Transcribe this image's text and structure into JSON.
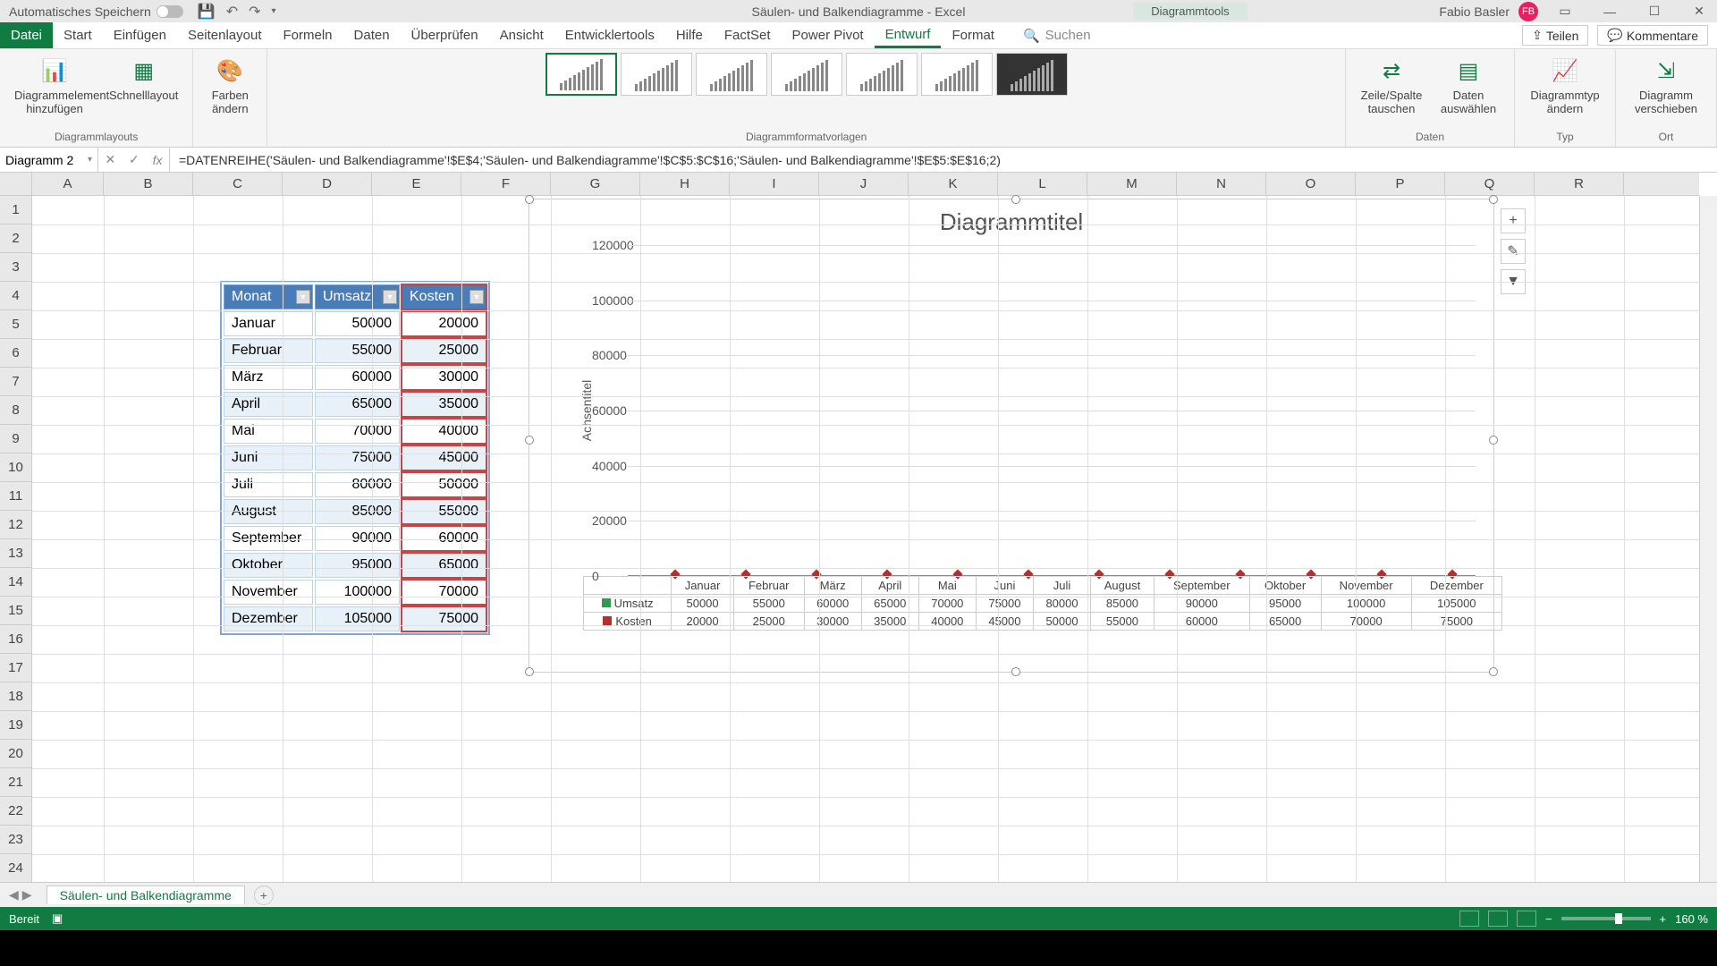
{
  "title_bar": {
    "autosave_label": "Automatisches Speichern",
    "doc_title": "Säulen- und Balkendiagramme - Excel",
    "tools_title": "Diagrammtools",
    "user_name": "Fabio Basler",
    "user_initials": "FB"
  },
  "ribbon_tabs": {
    "file": "Datei",
    "tabs": [
      "Start",
      "Einfügen",
      "Seitenlayout",
      "Formeln",
      "Daten",
      "Überprüfen",
      "Ansicht",
      "Entwicklertools",
      "Hilfe",
      "FactSet",
      "Power Pivot",
      "Entwurf",
      "Format"
    ],
    "active": "Entwurf",
    "search_placeholder": "Suchen",
    "share": "Teilen",
    "comments": "Kommentare"
  },
  "ribbon": {
    "group_layouts": "Diagrammlayouts",
    "btn_add_element": "Diagrammelement hinzufügen",
    "btn_quick_layout": "Schnelllayout",
    "btn_colors": "Farben ändern",
    "group_styles": "Diagrammformatvorlagen",
    "group_data": "Daten",
    "btn_switch": "Zeile/Spalte tauschen",
    "btn_select_data": "Daten auswählen",
    "group_type": "Typ",
    "btn_change_type": "Diagrammtyp ändern",
    "group_location": "Ort",
    "btn_move": "Diagramm verschieben"
  },
  "formula_bar": {
    "name_box": "Diagramm 2",
    "formula": "=DATENREIHE('Säulen- und Balkendiagramme'!$E$4;'Säulen- und Balkendiagramme'!$C$5:$C$16;'Säulen- und Balkendiagramme'!$E$5:$E$16;2)"
  },
  "columns": [
    "A",
    "B",
    "C",
    "D",
    "E",
    "F",
    "G",
    "H",
    "I",
    "J",
    "K",
    "L",
    "M",
    "N",
    "O",
    "P",
    "Q",
    "R"
  ],
  "table": {
    "headers": {
      "monat": "Monat",
      "umsatz": "Umsatz",
      "kosten": "Kosten"
    },
    "rows": [
      {
        "monat": "Januar",
        "umsatz": "50000",
        "kosten": "20000"
      },
      {
        "monat": "Februar",
        "umsatz": "55000",
        "kosten": "25000"
      },
      {
        "monat": "März",
        "umsatz": "60000",
        "kosten": "30000"
      },
      {
        "monat": "April",
        "umsatz": "65000",
        "kosten": "35000"
      },
      {
        "monat": "Mai",
        "umsatz": "70000",
        "kosten": "40000"
      },
      {
        "monat": "Juni",
        "umsatz": "75000",
        "kosten": "45000"
      },
      {
        "monat": "Juli",
        "umsatz": "80000",
        "kosten": "50000"
      },
      {
        "monat": "August",
        "umsatz": "85000",
        "kosten": "55000"
      },
      {
        "monat": "September",
        "umsatz": "90000",
        "kosten": "60000"
      },
      {
        "monat": "Oktober",
        "umsatz": "95000",
        "kosten": "65000"
      },
      {
        "monat": "November",
        "umsatz": "100000",
        "kosten": "70000"
      },
      {
        "monat": "Dezember",
        "umsatz": "105000",
        "kosten": "75000"
      }
    ]
  },
  "chart_data": {
    "type": "bar",
    "title": "Diagrammtitel",
    "ylabel": "Achsentitel",
    "ylim": [
      0,
      120000
    ],
    "yticks": [
      "0",
      "20000",
      "40000",
      "60000",
      "80000",
      "100000",
      "120000"
    ],
    "categories": [
      "Januar",
      "Februar",
      "März",
      "April",
      "Mai",
      "Juni",
      "Juli",
      "August",
      "September",
      "Oktober",
      "November",
      "Dezember"
    ],
    "series": [
      {
        "name": "Umsatz",
        "color": "#2e9b4f",
        "values": [
          50000,
          55000,
          60000,
          65000,
          70000,
          75000,
          80000,
          85000,
          90000,
          95000,
          100000,
          105000
        ]
      },
      {
        "name": "Kosten",
        "color": "#b82e2e",
        "values": [
          20000,
          25000,
          30000,
          35000,
          40000,
          45000,
          50000,
          55000,
          60000,
          65000,
          70000,
          75000
        ]
      }
    ]
  },
  "sheet_bar": {
    "tab_name": "Säulen- und Balkendiagramme"
  },
  "status_bar": {
    "ready": "Bereit",
    "zoom": "160 %"
  }
}
